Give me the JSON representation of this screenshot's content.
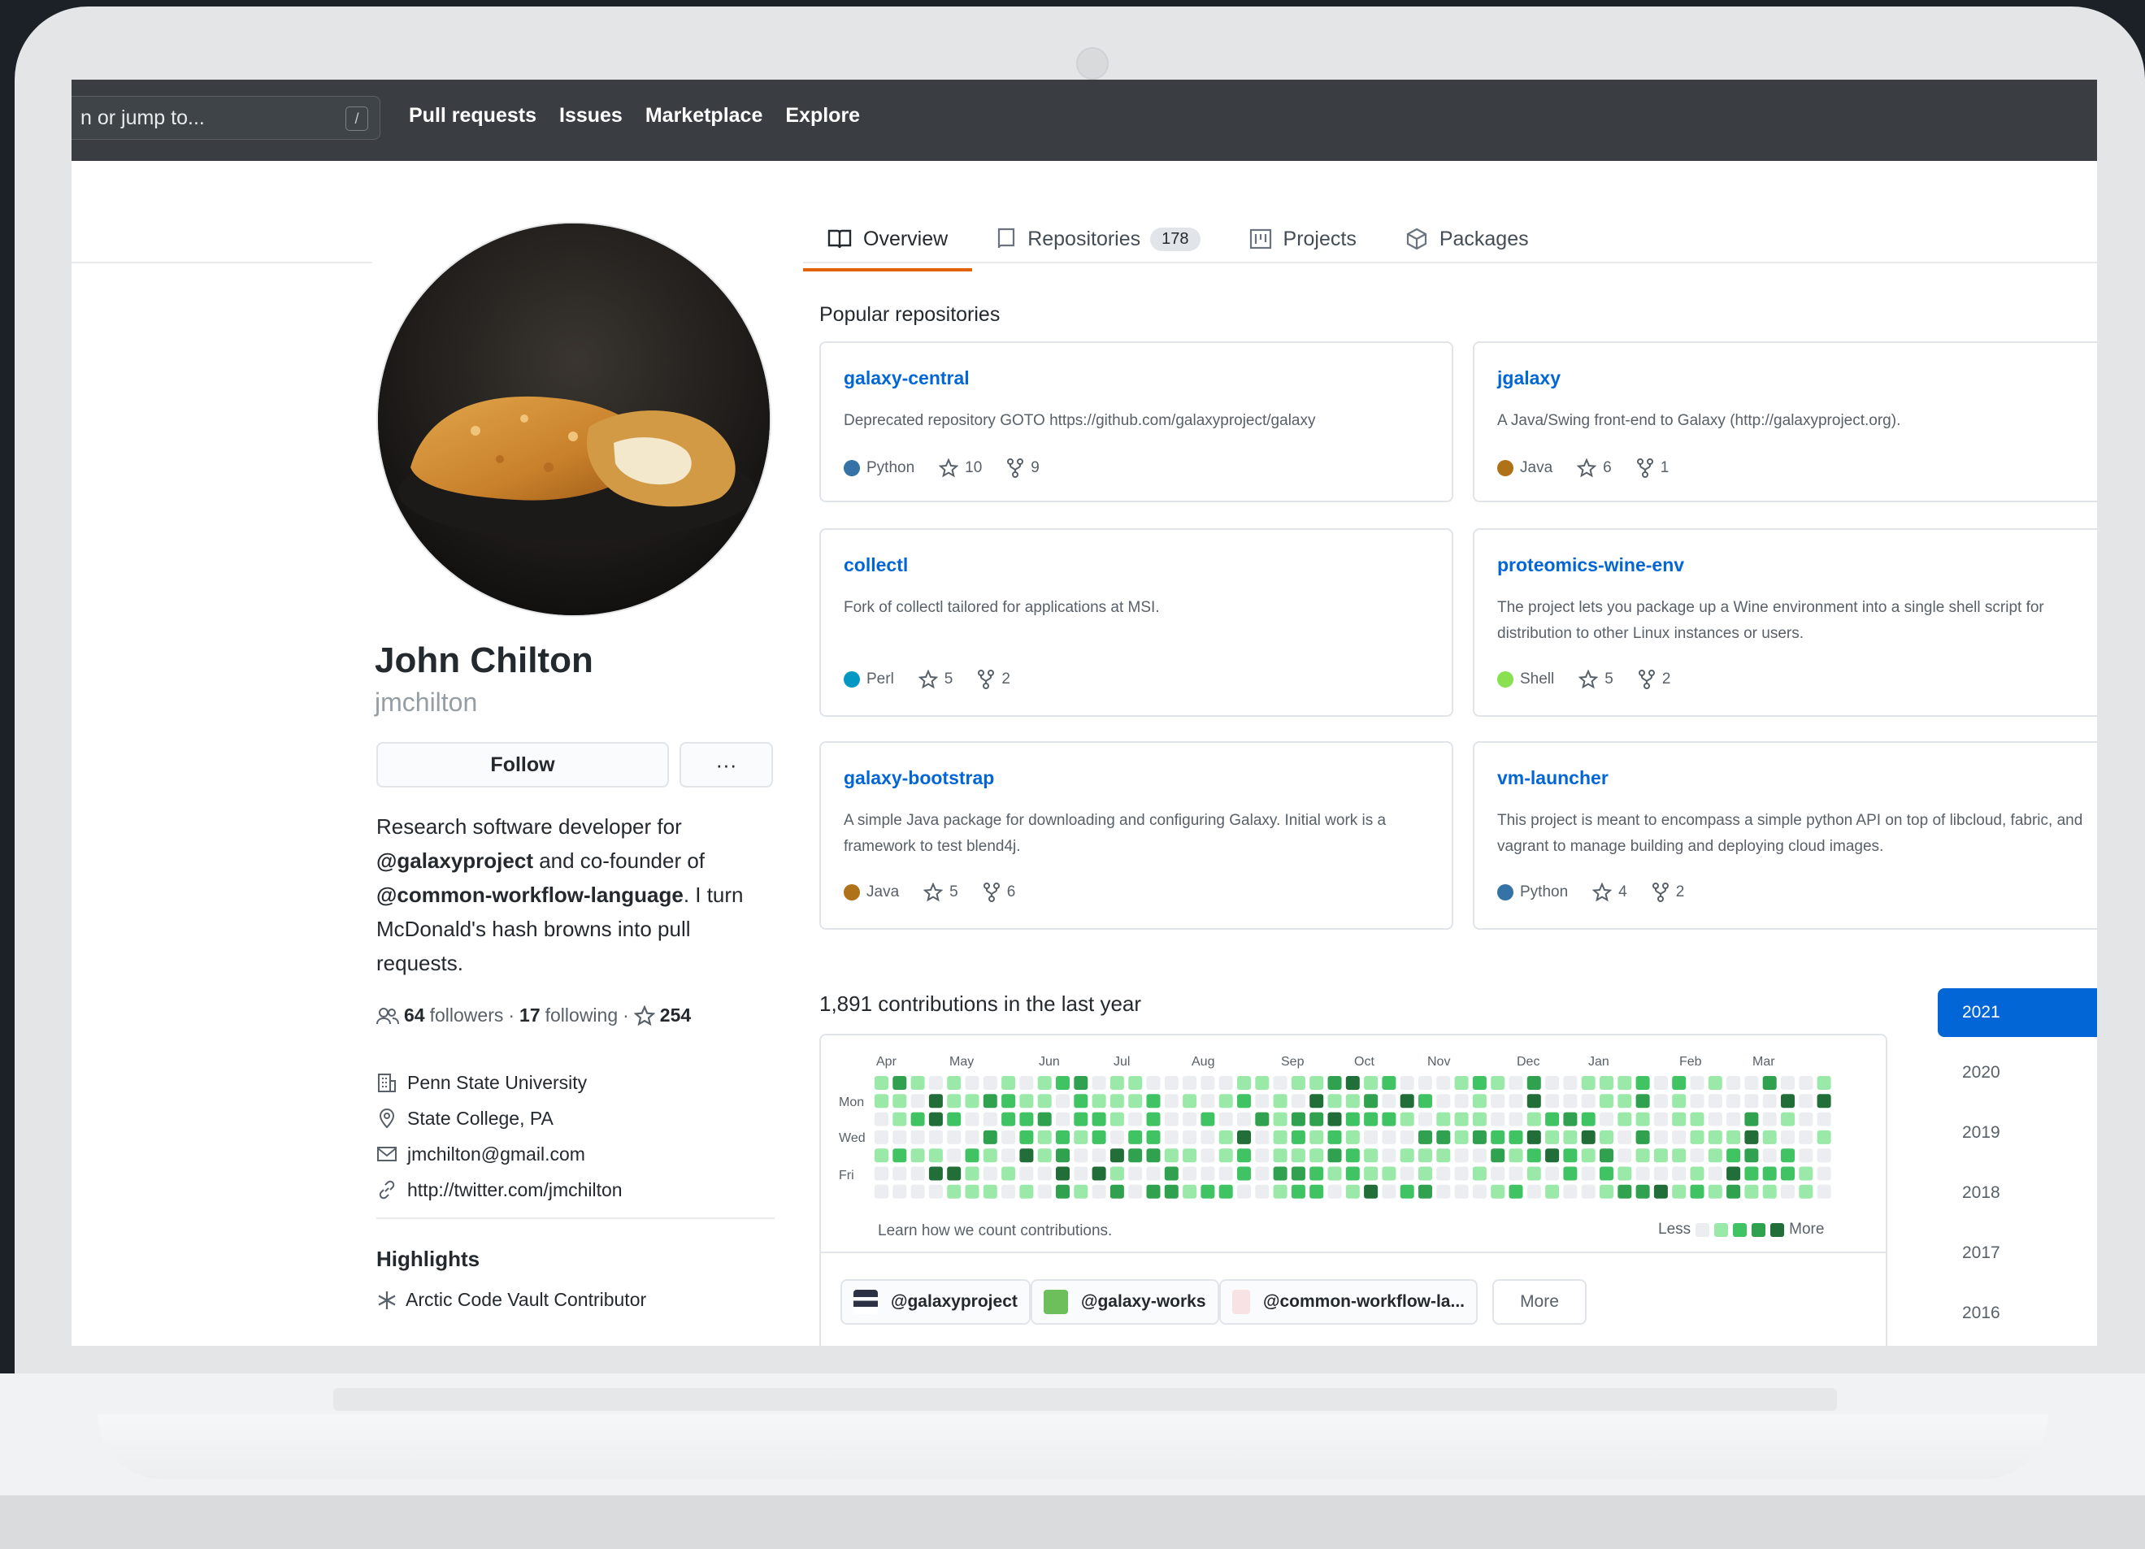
{
  "header": {
    "search_placeholder": "n or jump to...",
    "search_hotkey": "/",
    "nav": [
      "Pull requests",
      "Issues",
      "Marketplace",
      "Explore"
    ]
  },
  "tabs": [
    {
      "label": "Overview",
      "icon": "book-icon",
      "active": true
    },
    {
      "label": "Repositories",
      "icon": "repo-icon",
      "count": "178"
    },
    {
      "label": "Projects",
      "icon": "project-icon"
    },
    {
      "label": "Packages",
      "icon": "package-icon"
    }
  ],
  "profile": {
    "name": "John Chilton",
    "username": "jmchilton",
    "follow_label": "Follow",
    "more_label": "···",
    "bio": {
      "line1": "Research software developer for",
      "org1": "@galaxyproject",
      "mid": " and co-founder of",
      "org2": "@common-workflow-language",
      "tail": ". I turn McDonald's hash browns into pull requests."
    },
    "followers_count": "64",
    "followers_label": "followers",
    "following_count": "17",
    "following_label": "following",
    "stars": "254",
    "company": "Penn State University",
    "location": "State College, PA",
    "email": "jmchilton@gmail.com",
    "website": "http://twitter.com/jmchilton",
    "highlights_title": "Highlights",
    "highlight": "Arctic Code Vault Contributor"
  },
  "popular": {
    "title": "Popular repositories",
    "repos": [
      {
        "name": "galaxy-central",
        "desc": "Deprecated repository GOTO https://github.com/galaxyproject/galaxy",
        "lang": "Python",
        "lang_color": "#3572A5",
        "stars": "10",
        "forks": "9"
      },
      {
        "name": "jgalaxy",
        "desc": "A Java/Swing front-end to Galaxy (http://galaxyproject.org).",
        "lang": "Java",
        "lang_color": "#b07219",
        "stars": "6",
        "forks": "1"
      },
      {
        "name": "collectl",
        "desc": "Fork of collectl tailored for applications at MSI.",
        "lang": "Perl",
        "lang_color": "#0298c3",
        "stars": "5",
        "forks": "2"
      },
      {
        "name": "proteomics-wine-env",
        "desc": "The project lets you package up a Wine environment into a single shell script for distribution to other Linux instances or users.",
        "lang": "Shell",
        "lang_color": "#89e051",
        "stars": "5",
        "forks": "2"
      },
      {
        "name": "galaxy-bootstrap",
        "desc": "A simple Java package for downloading and configuring Galaxy. Initial work is a framework to test blend4j.",
        "lang": "Java",
        "lang_color": "#b07219",
        "stars": "5",
        "forks": "6"
      },
      {
        "name": "vm-launcher",
        "desc": "This project is meant to encompass a simple python API on top of libcloud, fabric, and vagrant to manage building and deploying cloud images.",
        "lang": "Python",
        "lang_color": "#3572A5",
        "stars": "4",
        "forks": "2"
      }
    ]
  },
  "contributions": {
    "title": "1,891 contributions in the last year",
    "months": [
      "Apr",
      "May",
      "Jun",
      "Jul",
      "Aug",
      "Sep",
      "Oct",
      "Nov",
      "Dec",
      "Jan",
      "Feb",
      "Mar"
    ],
    "days": [
      "Mon",
      "Wed",
      "Fri"
    ],
    "learn": "Learn how we count contributions.",
    "less": "Less",
    "more": "More",
    "colors": [
      "#ebedf0",
      "#9be9a8",
      "#40c463",
      "#30a14e",
      "#216e39"
    ]
  },
  "orgs": {
    "items": [
      "@galaxyproject",
      "@galaxy-works",
      "@common-workflow-la..."
    ],
    "more": "More"
  },
  "years": [
    "2021",
    "2020",
    "2019",
    "2018",
    "2017",
    "2016"
  ]
}
